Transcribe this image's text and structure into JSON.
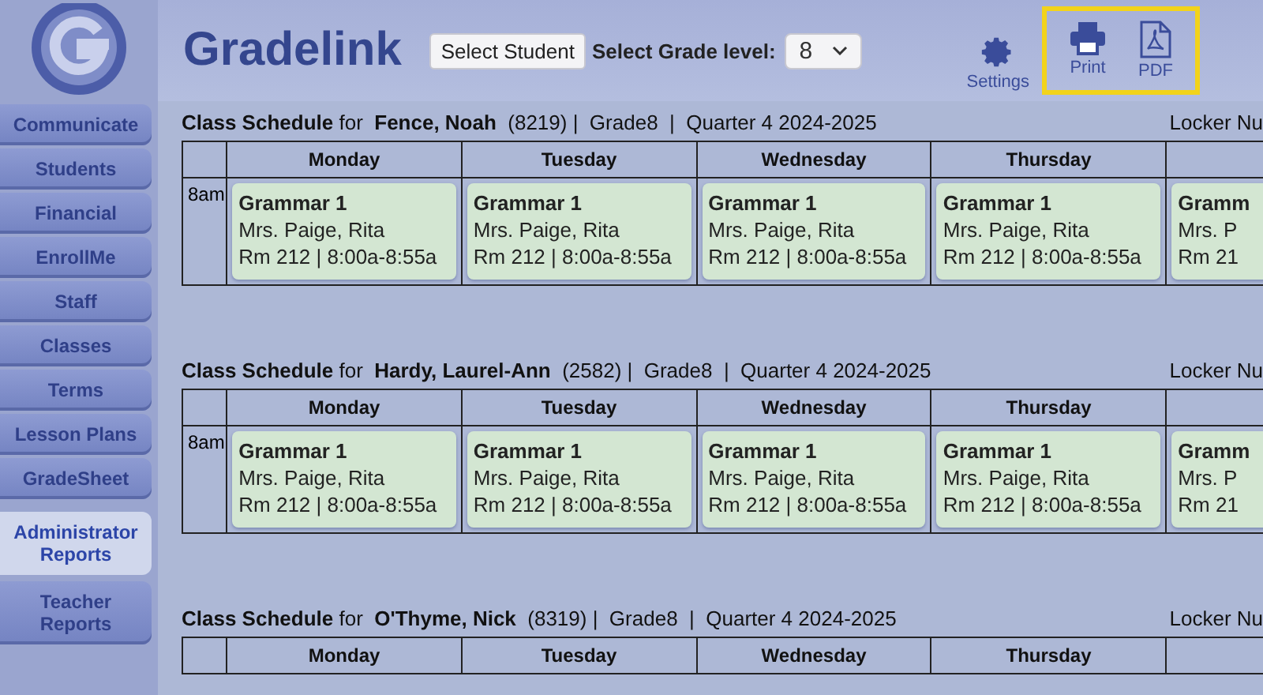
{
  "app": {
    "name": "Gradelink"
  },
  "toolbar": {
    "select_student": "Select Student",
    "grade_label": "Select Grade level:",
    "grade_value": "8",
    "actions": [
      {
        "kind": "settings",
        "label": "Settings",
        "highlighted": false
      },
      {
        "kind": "print",
        "label": "Print",
        "highlighted": true
      },
      {
        "kind": "pdf",
        "label": "PDF",
        "highlighted": true
      }
    ]
  },
  "sidebar": {
    "items": [
      {
        "label": "Communicate",
        "selected": false
      },
      {
        "label": "Students",
        "selected": false
      },
      {
        "label": "Financial",
        "selected": false
      },
      {
        "label": "EnrollMe",
        "selected": false
      },
      {
        "label": "Staff",
        "selected": false
      },
      {
        "label": "Classes",
        "selected": false
      },
      {
        "label": "Terms",
        "selected": false
      },
      {
        "label": "Lesson Plans",
        "selected": false
      },
      {
        "label": "GradeSheet",
        "selected": false
      },
      {
        "label": "Administrator Reports",
        "selected": true
      },
      {
        "label": "Teacher Reports",
        "selected": false
      }
    ]
  },
  "schedules": [
    {
      "title": "**Class Schedule** for  **Fence, Noah**  (8219) |  Grade8  |  Quarter 4 2024-2025",
      "locker": "Locker Nu",
      "columns": [
        "Monday",
        "Tuesday",
        "Wednesday",
        "Thursday"
      ],
      "rows": [
        {
          "time": "8am",
          "cells": [
            {
              "course": "Grammar 1",
              "teacher": "Mrs. Paige, Rita",
              "room": "Rm 212 | 8:00a-8:55a"
            },
            {
              "course": "Grammar 1",
              "teacher": "Mrs. Paige, Rita",
              "room": "Rm 212 | 8:00a-8:55a"
            },
            {
              "course": "Grammar 1",
              "teacher": "Mrs. Paige, Rita",
              "room": "Rm 212 | 8:00a-8:55a"
            },
            {
              "course": "Grammar 1",
              "teacher": "Mrs. Paige, Rita",
              "room": "Rm 212 | 8:00a-8:55a"
            },
            {
              "course": "Gramm",
              "teacher": "Mrs. P",
              "room": "Rm 21"
            }
          ]
        }
      ]
    },
    {
      "title": "**Class Schedule** for  **Hardy, Laurel-Ann**  (2582) |  Grade8  |  Quarter 4 2024-2025",
      "locker": "Locker Nu",
      "columns": [
        "Monday",
        "Tuesday",
        "Wednesday",
        "Thursday"
      ],
      "rows": [
        {
          "time": "8am",
          "cells": [
            {
              "course": "Grammar 1",
              "teacher": "Mrs. Paige, Rita",
              "room": "Rm 212 | 8:00a-8:55a"
            },
            {
              "course": "Grammar 1",
              "teacher": "Mrs. Paige, Rita",
              "room": "Rm 212 | 8:00a-8:55a"
            },
            {
              "course": "Grammar 1",
              "teacher": "Mrs. Paige, Rita",
              "room": "Rm 212 | 8:00a-8:55a"
            },
            {
              "course": "Grammar 1",
              "teacher": "Mrs. Paige, Rita",
              "room": "Rm 212 | 8:00a-8:55a"
            },
            {
              "course": "Gramm",
              "teacher": "Mrs. P",
              "room": "Rm 21"
            }
          ]
        }
      ]
    },
    {
      "title": "**Class Schedule** for  **O'Thyme, Nick**  (8319) |  Grade8  |  Quarter 4 2024-2025",
      "locker": "Locker Nu",
      "columns": [
        "Monday",
        "Tuesday",
        "Wednesday",
        "Thursday"
      ]
    }
  ]
}
